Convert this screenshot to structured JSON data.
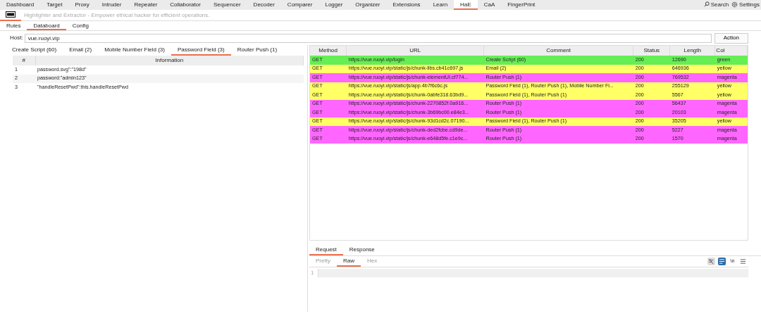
{
  "nav": {
    "tabs": [
      {
        "label": "Dashboard",
        "selected": false
      },
      {
        "label": "Target",
        "selected": false
      },
      {
        "label": "Proxy",
        "selected": false
      },
      {
        "label": "Intruder",
        "selected": false
      },
      {
        "label": "Repeater",
        "selected": false
      },
      {
        "label": "Collaborator",
        "selected": false
      },
      {
        "label": "Sequencer",
        "selected": false
      },
      {
        "label": "Decoder",
        "selected": false
      },
      {
        "label": "Comparer",
        "selected": false
      },
      {
        "label": "Logger",
        "selected": false
      },
      {
        "label": "Organizer",
        "selected": false
      },
      {
        "label": "Extensions",
        "selected": false
      },
      {
        "label": "Learn",
        "selected": false
      },
      {
        "label": "HaE",
        "selected": true
      },
      {
        "label": "CaA",
        "selected": false
      },
      {
        "label": "FingerPrint",
        "selected": false
      }
    ],
    "search": "Search",
    "settings": "Settings"
  },
  "header": {
    "subtitle": "Highlighter and Extractor - Empower ethical hacker for efficient operations."
  },
  "subtabs": [
    {
      "label": "Rules",
      "selected": false
    },
    {
      "label": "Databoard",
      "selected": true
    },
    {
      "label": "Config",
      "selected": false
    }
  ],
  "host": {
    "label": "Host:",
    "value": "vue.ruoyi.vip",
    "action": "Action"
  },
  "left": {
    "tabs": [
      {
        "label": "Create Script (60)",
        "selected": false
      },
      {
        "label": "Email (2)",
        "selected": false
      },
      {
        "label": "Mobile Number Field (3)",
        "selected": false
      },
      {
        "label": "Password Field (3)",
        "selected": true
      },
      {
        "label": "Router Push (1)",
        "selected": false
      }
    ],
    "columns": [
      "#",
      "Information"
    ],
    "rows": [
      {
        "index": "1",
        "information": "password.svg\":\"198d\""
      },
      {
        "index": "2",
        "information": "password:\"admin123\""
      },
      {
        "index": "3",
        "information": "\"handleResetPwd\":this.handleResetPwd"
      }
    ]
  },
  "right": {
    "columns": [
      "Method",
      "URL",
      "Comment",
      "Status",
      "Length",
      "Col"
    ],
    "rows": [
      {
        "method": "GET",
        "url": "https://vue.ruoyi.vip/login",
        "comment": "Create Script (60)",
        "status": "200",
        "length": "12690",
        "highlight": "green",
        "color": "#66ee55"
      },
      {
        "method": "GET",
        "url": "https://vue.ruoyi.vip/static/js/chunk-libs.cb41c697.js",
        "comment": "Email (2)",
        "status": "200",
        "length": "646936",
        "highlight": "yellow",
        "color": "#ffff66"
      },
      {
        "method": "GET",
        "url": "https://vue.ruoyi.vip/static/js/chunk-elementUI.cf774...",
        "comment": "Router Push (1)",
        "status": "200",
        "length": "769532",
        "highlight": "magenta",
        "color": "#ff66ff"
      },
      {
        "method": "GET",
        "url": "https://vue.ruoyi.vip/static/js/app.4b7f6c6c.js",
        "comment": "Password Field (1), Router Push (1), Mobile Number Fi...",
        "status": "200",
        "length": "255129",
        "highlight": "yellow",
        "color": "#ffff66"
      },
      {
        "method": "GET",
        "url": "https://vue.ruoyi.vip/static/js/chunk-0abfe318.63bd9...",
        "comment": "Password Field (1), Router Push (1)",
        "status": "200",
        "length": "5567",
        "highlight": "yellow",
        "color": "#ffff66"
      },
      {
        "method": "GET",
        "url": "https://vue.ruoyi.vip/static/js/chunk-2270852f.0a916...",
        "comment": "Router Push (1)",
        "status": "200",
        "length": "56437",
        "highlight": "magenta",
        "color": "#ff66ff"
      },
      {
        "method": "GET",
        "url": "https://vue.ruoyi.vip/static/js/chunk-3b69bc00.e84e3...",
        "comment": "Router Push (1)",
        "status": "200",
        "length": "20103",
        "highlight": "magenta",
        "color": "#ff66ff"
      },
      {
        "method": "GET",
        "url": "https://vue.ruoyi.vip/static/js/chunk-93d1cd2c.07190...",
        "comment": "Password Field (1), Router Push (1)",
        "status": "200",
        "length": "35205",
        "highlight": "yellow",
        "color": "#ffff66"
      },
      {
        "method": "GET",
        "url": "https://vue.ruoyi.vip/static/js/chunk-ded2fcbe.cd9de...",
        "comment": "Router Push (1)",
        "status": "200",
        "length": "5227",
        "highlight": "magenta",
        "color": "#ff66ff"
      },
      {
        "method": "GET",
        "url": "https://vue.ruoyi.vip/static/js/chunk-e648d5fe.c1e9c...",
        "comment": "Router Push (1)",
        "status": "200",
        "length": "1570",
        "highlight": "magenta",
        "color": "#ff66ff"
      }
    ]
  },
  "message": {
    "tabs": [
      {
        "label": "Request",
        "selected": true
      },
      {
        "label": "Response",
        "selected": false
      }
    ],
    "views": [
      {
        "label": "Pretty",
        "selected": false
      },
      {
        "label": "Raw",
        "selected": true
      },
      {
        "label": "Hex",
        "selected": false
      }
    ],
    "tools": [
      {
        "kind": "wrap",
        "selected": false
      },
      {
        "kind": "render",
        "selected": true
      },
      {
        "kind": "newline",
        "label": "\\n",
        "selected": false
      },
      {
        "kind": "menu",
        "selected": false
      }
    ],
    "line_number": "1"
  }
}
